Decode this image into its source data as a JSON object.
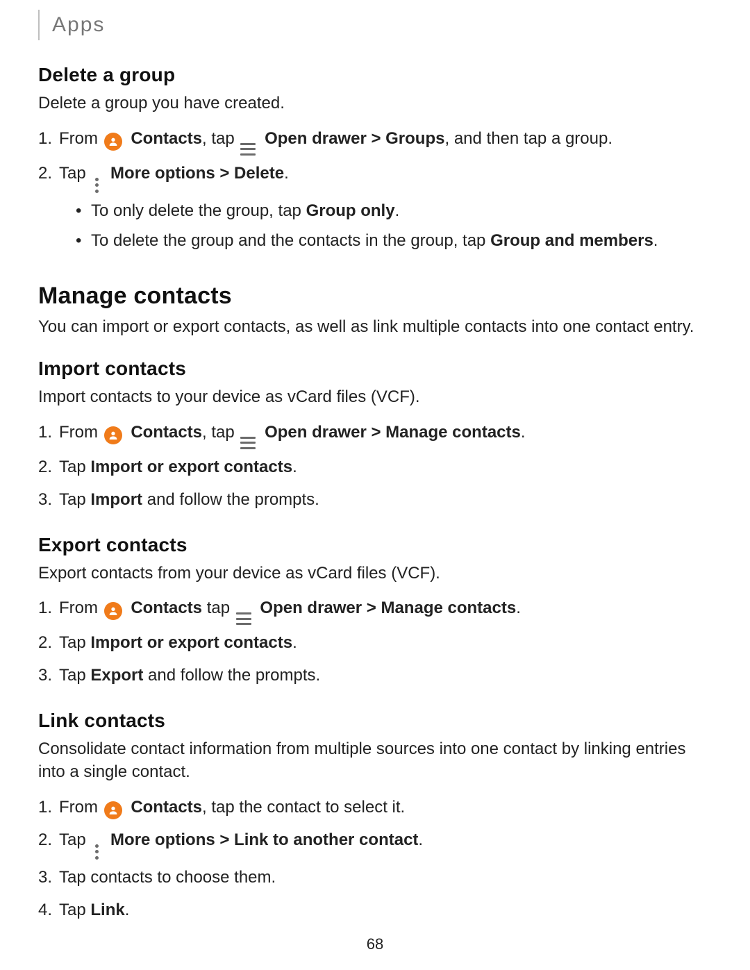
{
  "header": {
    "breadcrumb": "Apps"
  },
  "page_number": "68",
  "s1": {
    "title": "Delete a group",
    "intro": "Delete a group you have created.",
    "step1": {
      "pre": "From ",
      "contacts": "Contacts",
      "mid": ", tap ",
      "opendrawer": "Open drawer > Groups",
      "tail": ", and then tap a group."
    },
    "step2": {
      "pre": "Tap ",
      "more": " More options > Delete",
      "tail": "."
    },
    "b1": {
      "text": "To only delete the group, tap ",
      "bold": "Group only",
      "tail": "."
    },
    "b2": {
      "text": "To delete the group and the contacts in the group, tap ",
      "bold": "Group and members",
      "tail": "."
    }
  },
  "s2": {
    "title": "Manage contacts",
    "intro": "You can import or export contacts, as well as link multiple contacts into one contact entry."
  },
  "s3": {
    "title": "Import contacts",
    "intro": "Import contacts to your device as vCard files (VCF).",
    "step1": {
      "pre": "From ",
      "contacts": "Contacts",
      "mid": ", tap ",
      "opendrawer": "Open drawer > Manage contacts",
      "tail": "."
    },
    "step2": {
      "pre": "Tap ",
      "bold": "Import or export contacts",
      "tail": "."
    },
    "step3": {
      "pre": "Tap ",
      "bold": "Import",
      "tail": " and follow the prompts."
    }
  },
  "s4": {
    "title": "Export contacts",
    "intro": "Export contacts from your device as vCard files (VCF).",
    "step1": {
      "pre": "From ",
      "contacts": "Contacts",
      "mid": " tap ",
      "opendrawer": "Open drawer > Manage contacts",
      "tail": "."
    },
    "step2": {
      "pre": "Tap ",
      "bold": "Import or export contacts",
      "tail": "."
    },
    "step3": {
      "pre": "Tap ",
      "bold": "Export",
      "tail": " and follow the prompts."
    }
  },
  "s5": {
    "title": "Link contacts",
    "intro": "Consolidate contact information from multiple sources into one contact by linking entries into a single contact.",
    "step1": {
      "pre": "From ",
      "contacts": "Contacts",
      "tail": ", tap the contact to select it."
    },
    "step2": {
      "pre": "Tap ",
      "more": " More options > Link to another contact",
      "tail": "."
    },
    "step3": {
      "text": "Tap contacts to choose them."
    },
    "step4": {
      "pre": "Tap ",
      "bold": "Link",
      "tail": "."
    }
  }
}
